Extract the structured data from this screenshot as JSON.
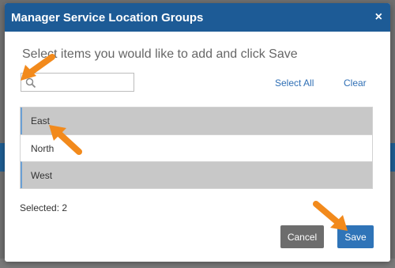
{
  "dialog": {
    "title": "Manager Service Location Groups",
    "close_symbol": "×",
    "instructions": "Select items you would like to add and click Save",
    "search": {
      "value": "",
      "placeholder": ""
    },
    "select_all_label": "Select All",
    "clear_label": "Clear",
    "items": [
      {
        "label": "East",
        "selected": true
      },
      {
        "label": "North",
        "selected": false
      },
      {
        "label": "West",
        "selected": true
      }
    ],
    "selected_count_text": "Selected: 2",
    "cancel_label": "Cancel",
    "save_label": "Save"
  },
  "colors": {
    "header": "#1d5b96",
    "selected_row": "#c8c8c8",
    "link": "#2f6fb5",
    "save_button": "#2f74b8",
    "cancel_button": "#6d6d6d",
    "annotation_arrow": "#f28a1c"
  },
  "icons": [
    "close-icon",
    "search-icon",
    "annotation-arrow-icon"
  ]
}
